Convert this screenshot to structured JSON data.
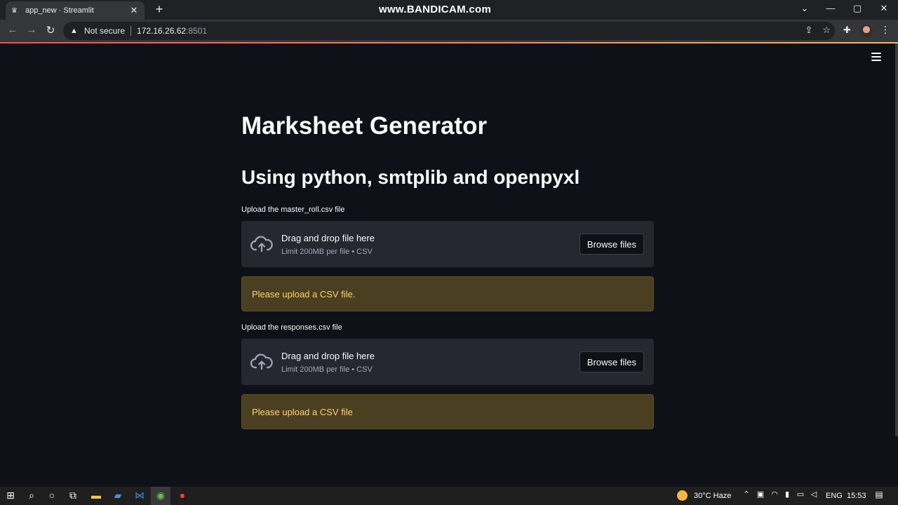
{
  "browser": {
    "tab_title": "app_new · Streamlit",
    "watermark": "www.BANDICAM.com",
    "security_label": "Not secure",
    "url_host": "172.16.26.62",
    "url_port": ":8501"
  },
  "app": {
    "title": "Marksheet Generator",
    "subtitle": "Using python, smtplib and openpyxl",
    "uploaders": [
      {
        "label": "Upload the master_roll.csv file",
        "drop_text": "Drag and drop file here",
        "limit_text": "Limit 200MB per file • CSV",
        "button": "Browse files",
        "warning": "Please upload a CSV file."
      },
      {
        "label": "Upload the responses.csv file",
        "drop_text": "Drag and drop file here",
        "limit_text": "Limit 200MB per file • CSV",
        "button": "Browse files",
        "warning": "Please upload a CSV file"
      }
    ]
  },
  "taskbar": {
    "weather": "30°C  Haze",
    "language": "ENG",
    "time": "15:53"
  },
  "colors": {
    "background": "#0e1117",
    "uploader_bg": "#262730",
    "warning_bg": "#4a4021",
    "warning_text": "#ffd16a",
    "accent_start": "#ff4b4b",
    "accent_end": "#ffbd45"
  }
}
